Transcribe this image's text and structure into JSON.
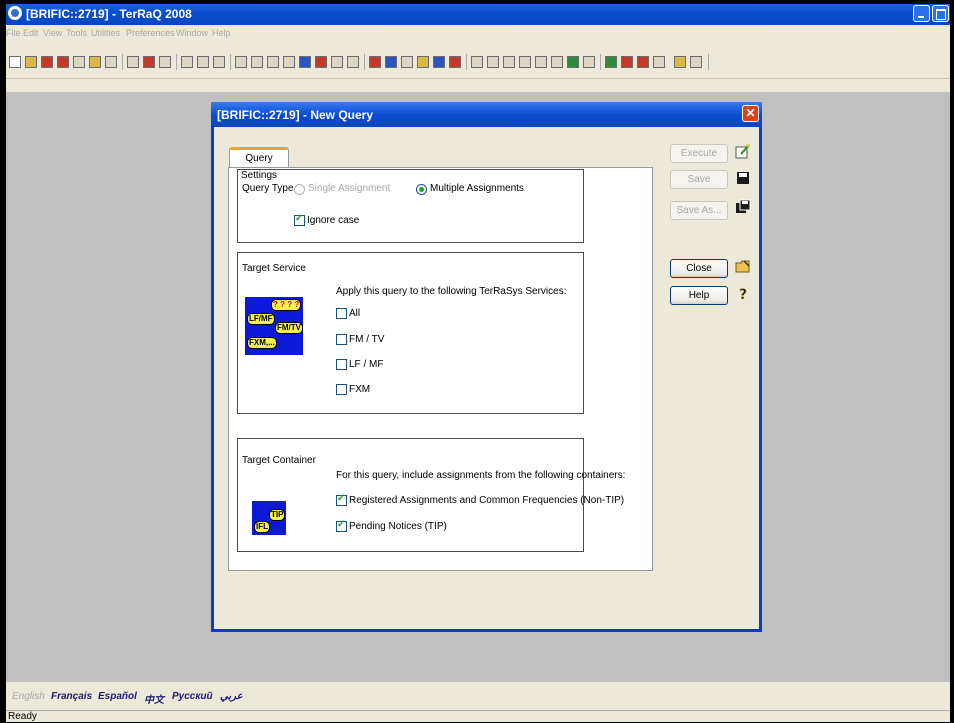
{
  "app": {
    "title": "[BRIFIC::2719] - TerRaQ 2008"
  },
  "menu": [
    "File",
    "Edit",
    "View",
    "Tools",
    "Utilities",
    "Preferences",
    "Window",
    "Help"
  ],
  "dialog": {
    "title": "[BRIFIC::2719] - New Query",
    "tab_label": "Query Settings",
    "query_type": {
      "label": "Query Type",
      "single": "Single Assignment",
      "multiple": "Multiple Assignments",
      "selected": "multiple",
      "ignore_case_label": "Ignore case",
      "ignore_case_checked": true
    },
    "target_service": {
      "title": "Target Service",
      "description": "Apply this query to the following TerRaSys Services:",
      "image_tags": [
        "? ? ? ?",
        "LF/MF",
        "FM/TV",
        "FXM,..."
      ],
      "options": [
        {
          "label": "All",
          "checked": false
        },
        {
          "label": "FM / TV",
          "checked": false
        },
        {
          "label": "LF / MF",
          "checked": false
        },
        {
          "label": "FXM",
          "checked": false
        }
      ]
    },
    "target_container": {
      "title": "Target Container",
      "description": "For this query, include assignments from the following containers:",
      "image_tags": [
        "TIP",
        "IFL"
      ],
      "options": [
        {
          "label": "Registered Assignments and Common Frequencies (Non-TIP)",
          "checked": true
        },
        {
          "label": "Pending Notices (TIP)",
          "checked": true
        }
      ]
    },
    "buttons": {
      "execute": "Execute",
      "save": "Save",
      "save_as": "Save As...",
      "close": "Close",
      "help": "Help"
    }
  },
  "languages": [
    "English",
    "Français",
    "Español",
    "中文",
    "Русский",
    "عربي"
  ],
  "status": {
    "text": "Ready"
  },
  "colors": {
    "titlebar": "#0a4ed0",
    "workspace": "#c0c0c0",
    "dialog_frame": "#0a3ad0"
  }
}
